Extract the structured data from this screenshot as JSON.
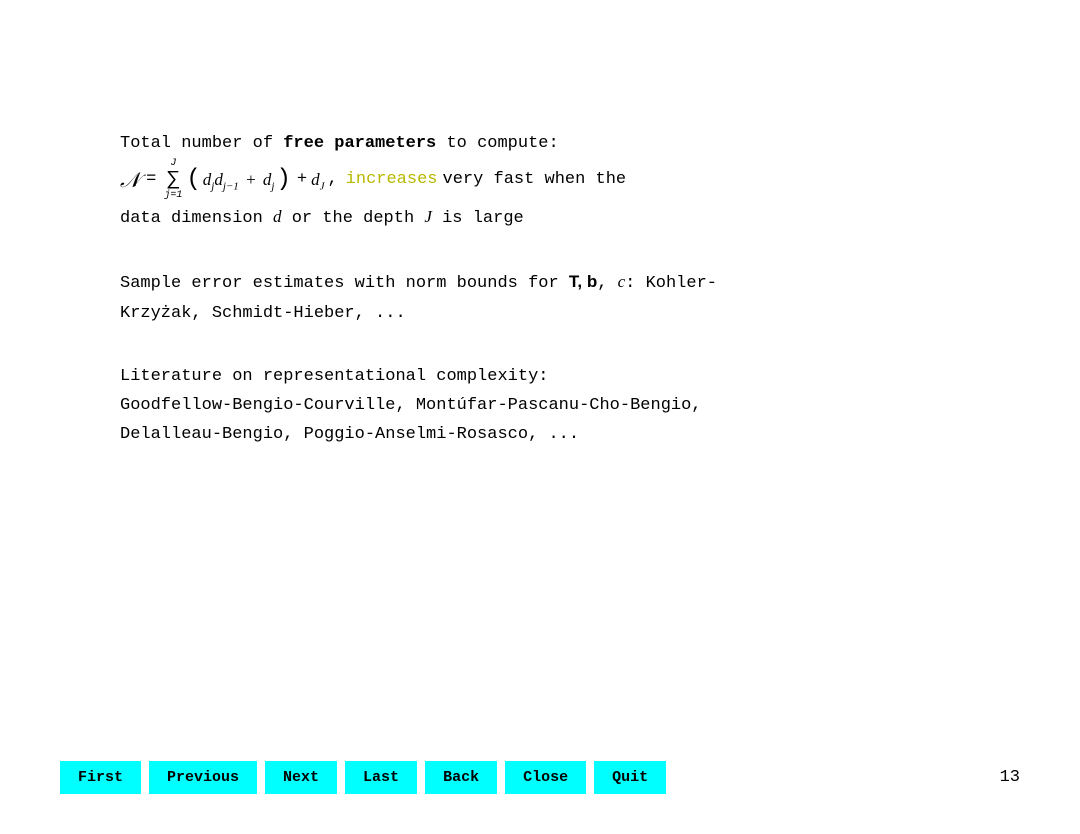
{
  "content": {
    "paragraph1": {
      "line1_pre": "Total number of ",
      "line1_bold": "free parameters",
      "line1_post": " to compute:",
      "line2_formula_desc": "N = Σ(j=1 to J) (d_j d_{j-1} + d_j) + d_J,",
      "line2_post": " increases very fast when the",
      "line3": "data dimension d or the depth J is large"
    },
    "paragraph2": {
      "line1_pre": "Sample error estimates with norm bounds for ",
      "line1_bold": "T, b",
      "line1_post_pre": ", c",
      "line1_post": ":  Kohler-",
      "line2": "Krzyżak, Schmidt-Hieber, ..."
    },
    "paragraph3": {
      "line1": "Literature on representational complexity:",
      "line2": "Goodfellow-Bengio-Courville,  Montúfar-Pascanu-Cho-Bengio,",
      "line3": "Delalleau-Bengio, Poggio-Anselmi-Rosasco, ..."
    }
  },
  "nav": {
    "buttons": [
      "First",
      "Previous",
      "Next",
      "Last",
      "Back",
      "Close",
      "Quit"
    ],
    "page_number": "13"
  },
  "colors": {
    "button_bg": "#00ffff",
    "increases_color": "#b8b800",
    "text_color": "#000000"
  }
}
